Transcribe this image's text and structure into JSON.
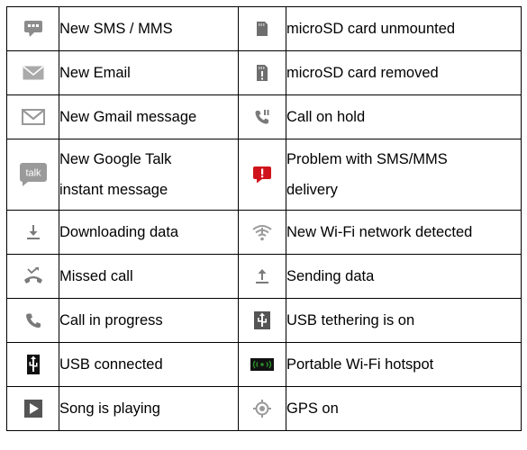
{
  "rows": [
    {
      "left": {
        "icon": "sms-icon",
        "label": "New SMS / MMS"
      },
      "right": {
        "icon": "sd-card-unmounted-icon",
        "label": "microSD card unmounted"
      }
    },
    {
      "left": {
        "icon": "email-icon",
        "label": "New Email"
      },
      "right": {
        "icon": "sd-card-removed-icon",
        "label": "microSD card removed"
      }
    },
    {
      "left": {
        "icon": "gmail-icon",
        "label": "New Gmail message"
      },
      "right": {
        "icon": "call-on-hold-icon",
        "label": "Call on hold"
      }
    },
    {
      "left": {
        "icon": "talk-icon",
        "label_line1": "New Google Talk",
        "label_line2": "instant message"
      },
      "right": {
        "icon": "sms-error-icon",
        "label_line1": "Problem with SMS/MMS",
        "label_line2": "delivery"
      }
    },
    {
      "left": {
        "icon": "download-icon",
        "label": "Downloading data"
      },
      "right": {
        "icon": "wifi-icon",
        "label": "New Wi-Fi network detected"
      }
    },
    {
      "left": {
        "icon": "missed-call-icon",
        "label": "Missed call"
      },
      "right": {
        "icon": "upload-icon",
        "label": "Sending data"
      }
    },
    {
      "left": {
        "icon": "call-in-progress-icon",
        "label": "Call in progress"
      },
      "right": {
        "icon": "usb-tethering-icon",
        "label": "USB tethering is on"
      }
    },
    {
      "left": {
        "icon": "usb-icon",
        "label": "USB connected"
      },
      "right": {
        "icon": "hotspot-icon",
        "label": "Portable Wi-Fi hotspot"
      }
    },
    {
      "left": {
        "icon": "play-icon",
        "label": "Song is playing"
      },
      "right": {
        "icon": "gps-icon",
        "label": "GPS on"
      }
    }
  ],
  "colors": {
    "grey_icon": "#8c8c8c",
    "error_red": "#d0131b",
    "hotspot_green": "#2a8a2a"
  }
}
